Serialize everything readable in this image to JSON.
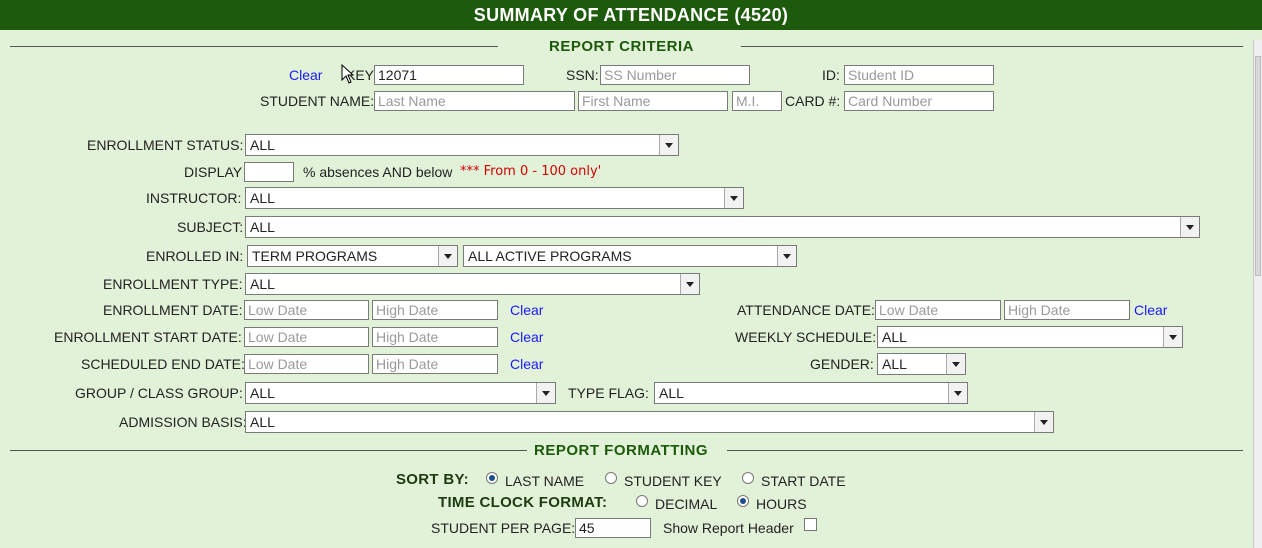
{
  "title": "SUMMARY OF ATTENDANCE (4520)",
  "sections": {
    "criteria": "REPORT CRITERIA",
    "formatting": "REPORT FORMATTING"
  },
  "row1": {
    "clear": "Clear",
    "key_label": "KEY:",
    "key_value": "12071",
    "ssn_label": "SSN:",
    "ssn_placeholder": "SS Number",
    "id_label": "ID:",
    "id_placeholder": "Student ID"
  },
  "row2": {
    "name_label": "STUDENT NAME:",
    "last_placeholder": "Last Name",
    "first_placeholder": "First Name",
    "mi_placeholder": "M.I.",
    "card_label": "CARD #:",
    "card_placeholder": "Card Number"
  },
  "enrollment_status": {
    "label": "ENROLLMENT STATUS:",
    "value": "ALL"
  },
  "display": {
    "label": "DISPLAY",
    "suffix": "% absences AND below",
    "warning": "*** From 0 - 100 only'"
  },
  "instructor": {
    "label": "INSTRUCTOR:",
    "value": "ALL"
  },
  "subject": {
    "label": "SUBJECT:",
    "value": "ALL"
  },
  "enrolled_in": {
    "label": "ENROLLED IN:",
    "value1": "TERM PROGRAMS",
    "value2": "ALL ACTIVE PROGRAMS"
  },
  "enrollment_type": {
    "label": "ENROLLMENT TYPE:",
    "value": "ALL"
  },
  "enrollment_date": {
    "label": "ENROLLMENT DATE:",
    "low": "Low Date",
    "high": "High Date",
    "clear": "Clear"
  },
  "attendance_date": {
    "label": "ATTENDANCE DATE:",
    "low": "Low Date",
    "high": "High Date",
    "clear": "Clear"
  },
  "enrollment_start_date": {
    "label": "ENROLLMENT START DATE:",
    "low": "Low Date",
    "high": "High Date",
    "clear": "Clear"
  },
  "weekly_schedule": {
    "label": "WEEKLY SCHEDULE:",
    "value": "ALL"
  },
  "scheduled_end_date": {
    "label": "SCHEDULED END DATE:",
    "low": "Low Date",
    "high": "High Date",
    "clear": "Clear"
  },
  "gender": {
    "label": "GENDER:",
    "value": "ALL"
  },
  "group_class": {
    "label": "GROUP / CLASS GROUP:",
    "value": "ALL"
  },
  "type_flag": {
    "label": "TYPE FLAG:",
    "value": "ALL"
  },
  "admission_basis": {
    "label": "ADMISSION BASIS:",
    "value": "ALL"
  },
  "sort_by": {
    "label": "SORT BY:",
    "options": [
      "LAST NAME",
      "STUDENT KEY",
      "START DATE"
    ],
    "selected": "LAST NAME"
  },
  "time_clock": {
    "label": "TIME CLOCK FORMAT:",
    "options": [
      "DECIMAL",
      "HOURS"
    ],
    "selected": "HOURS"
  },
  "per_page": {
    "label": "STUDENT PER PAGE:",
    "value": "45"
  },
  "show_header": {
    "label": "Show Report Header",
    "checked": false
  },
  "colors": {
    "header_bg": "#1e5a0c",
    "page_bg": "#e2f2d9",
    "section_title": "#1e5a0c",
    "link": "#1a1aff",
    "warning": "#d40000"
  }
}
